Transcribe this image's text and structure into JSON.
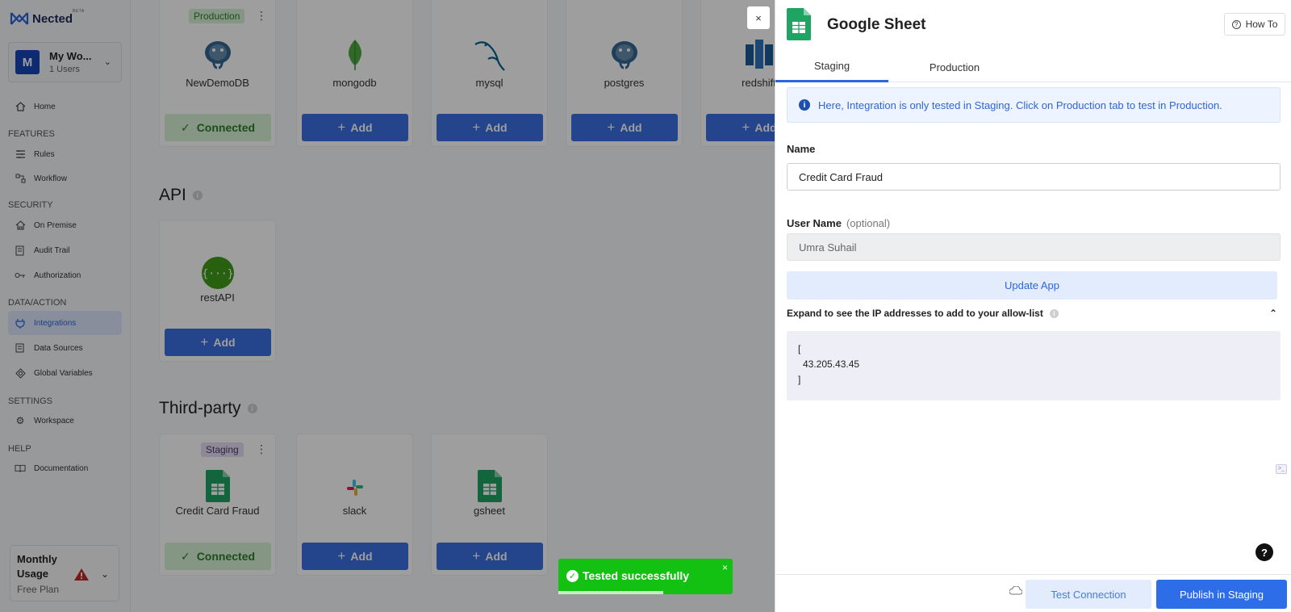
{
  "app": {
    "logo_text": "Nected",
    "beta": "BETA"
  },
  "workspace": {
    "avatar": "M",
    "name": "My Wo...",
    "users": "1 Users"
  },
  "sidebar": {
    "items": [
      {
        "label": "Home",
        "icon": "home-icon"
      },
      {
        "section": "FEATURES"
      },
      {
        "label": "Rules",
        "icon": "rules-icon"
      },
      {
        "label": "Workflow",
        "icon": "workflow-icon"
      },
      {
        "section": "SECURITY"
      },
      {
        "label": "On Premise",
        "icon": "on-premise-icon"
      },
      {
        "label": "Audit Trail",
        "icon": "audit-trail-icon"
      },
      {
        "label": "Authorization",
        "icon": "key-icon"
      },
      {
        "section": "DATA/ACTION"
      },
      {
        "label": "Integrations",
        "icon": "plug-icon",
        "active": true
      },
      {
        "label": "Data Sources",
        "icon": "data-sources-icon"
      },
      {
        "label": "Global Variables",
        "icon": "global-variables-icon"
      },
      {
        "section": "SETTINGS"
      },
      {
        "label": "Workspace",
        "icon": "gear-icon"
      },
      {
        "section": "HELP"
      },
      {
        "label": "Documentation",
        "icon": "book-icon"
      }
    ],
    "usage": {
      "title": "Monthly Usage",
      "plan": "Free Plan"
    }
  },
  "main": {
    "databases": [
      {
        "name": "NewDemoDB",
        "icon": "postgres-icon",
        "tag": "Production",
        "action": "Connected"
      },
      {
        "name": "mongodb",
        "icon": "mongodb-icon",
        "action": "Add"
      },
      {
        "name": "mysql",
        "icon": "mysql-icon",
        "action": "Add"
      },
      {
        "name": "postgres",
        "icon": "postgres-icon",
        "action": "Add"
      },
      {
        "name": "redshift",
        "icon": "redshift-icon",
        "action": "Add"
      }
    ],
    "api_title": "API",
    "api": [
      {
        "name": "restAPI",
        "icon": "rest-api-icon",
        "action": "Add"
      }
    ],
    "third_party_title": "Third-party",
    "third_party": [
      {
        "name": "Credit Card Fraud",
        "icon": "google-sheet-icon",
        "tag": "Staging",
        "action": "Connected"
      },
      {
        "name": "slack",
        "icon": "slack-icon",
        "action": "Add"
      },
      {
        "name": "gsheet",
        "icon": "google-sheet-icon",
        "action": "Add"
      }
    ]
  },
  "toast": {
    "message": "Tested successfully",
    "close": "×",
    "progress": 0.6
  },
  "panel": {
    "close": "×",
    "title": "Google Sheet",
    "how_to": "How To",
    "tabs": [
      "Staging",
      "Production"
    ],
    "banner": "Here, Integration is only tested in Staging. Click on Production tab to test in Production.",
    "name_label": "Name",
    "name_value": "Credit Card Fraud",
    "username_label": "User Name",
    "username_optional": "(optional)",
    "username_value": "Umra Suhail",
    "update_button": "Update App",
    "expand_label": "Expand to see the IP addresses to add to your allow-list",
    "ip_open": "[",
    "ip_address": "43.205.43.45",
    "ip_close": "]",
    "test_button": "Test Connection",
    "publish_button": "Publish in Staging",
    "help": "?"
  }
}
